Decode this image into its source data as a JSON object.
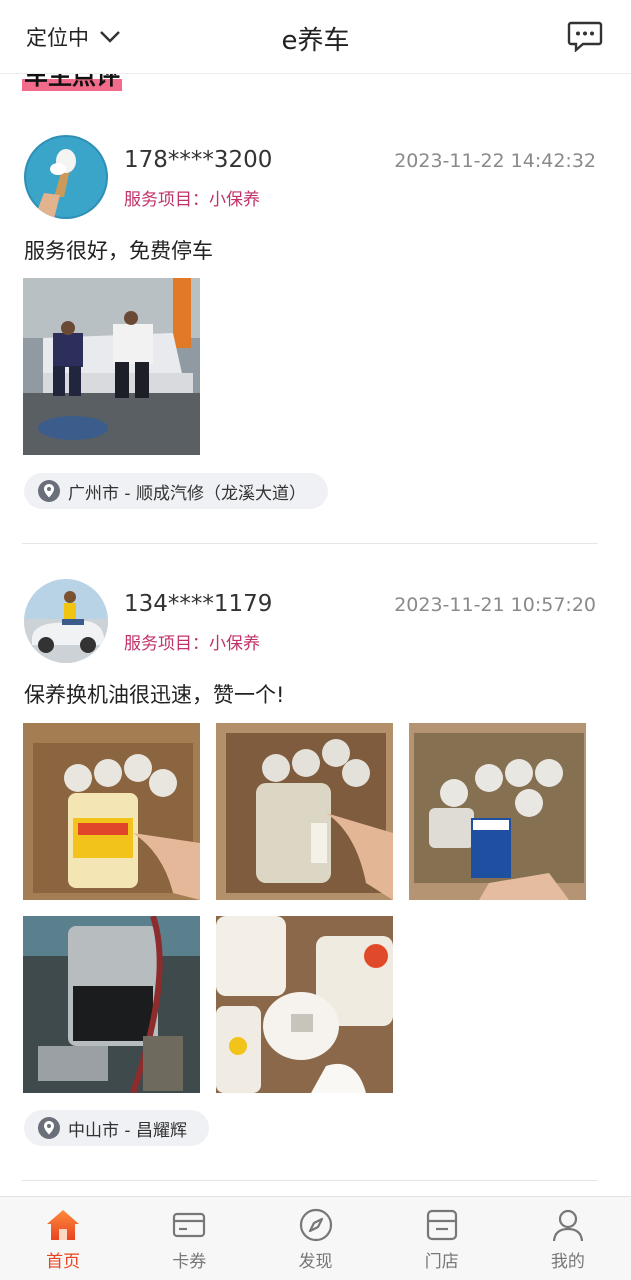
{
  "header": {
    "location_label": "定位中",
    "title": "e养车"
  },
  "section": {
    "title": "车主点评"
  },
  "reviews": [
    {
      "user": "178****3200",
      "datetime": "2023-11-22 14:42:32",
      "service": "服务项目：小保养",
      "comment": "服务很好，免费停车",
      "location": "广州市 - 顺成汽修（龙溪大道）"
    },
    {
      "user": "134****1179",
      "datetime": "2023-11-21 10:57:20",
      "service": "服务项目：小保养",
      "comment": "保养换机油很迅速，赞一个!",
      "location": "中山市 - 昌耀辉"
    }
  ],
  "tabs": [
    {
      "label": "首页",
      "icon": "home-icon"
    },
    {
      "label": "卡券",
      "icon": "card-icon"
    },
    {
      "label": "发现",
      "icon": "compass-icon"
    },
    {
      "label": "门店",
      "icon": "store-icon"
    },
    {
      "label": "我的",
      "icon": "user-icon"
    }
  ],
  "colors": {
    "accent": "#e8451f",
    "service_text": "#c0326a",
    "pill_bg": "#f0f1f5"
  }
}
